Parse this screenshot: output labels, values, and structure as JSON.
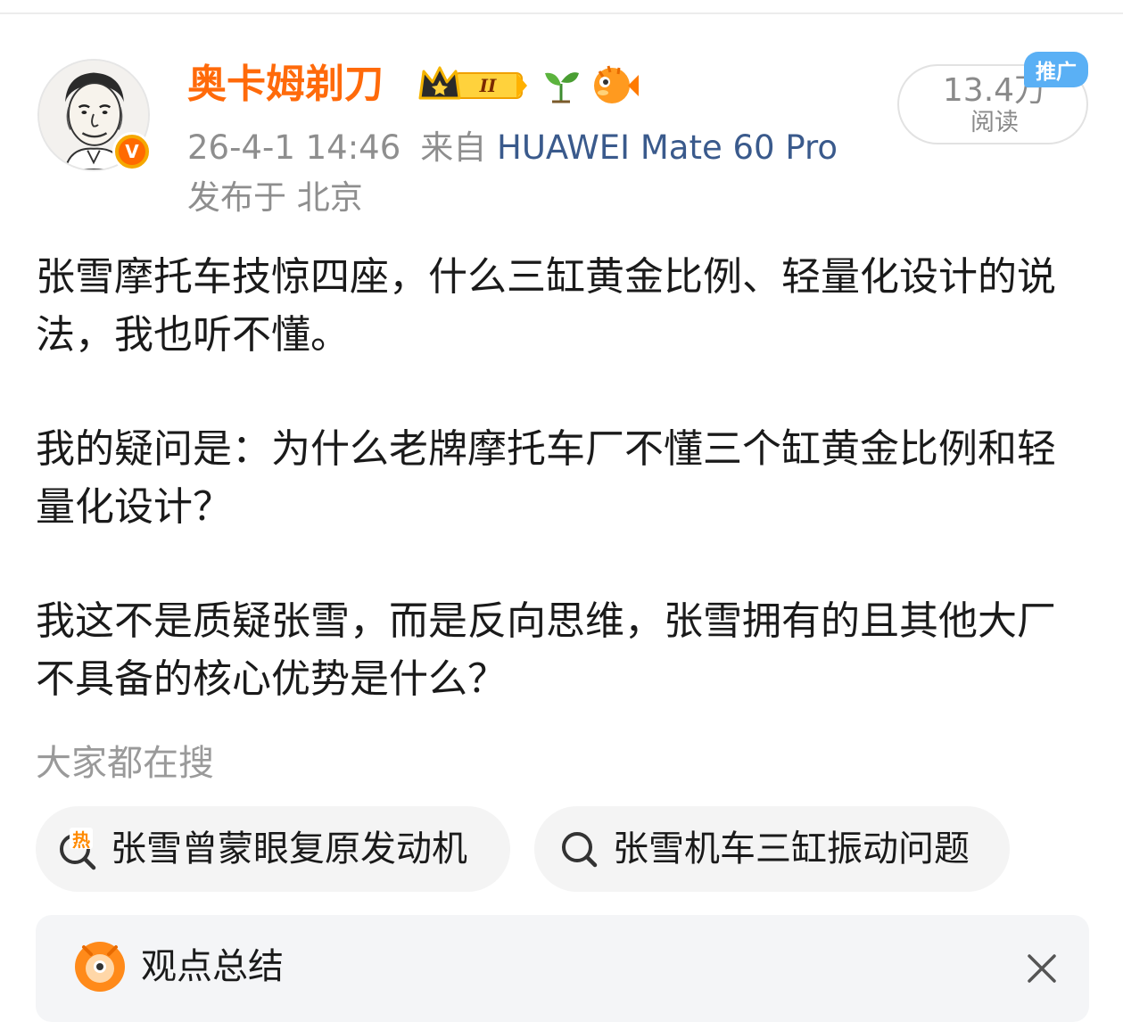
{
  "post": {
    "author": {
      "name": "奥卡姆剃刀",
      "verified_badge": "V",
      "level_badge": "II"
    },
    "meta": {
      "time": "26-4-1 14:46",
      "source_prefix": "来自",
      "device": "HUAWEI Mate 60 Pro",
      "location": "发布于 北京"
    },
    "reads": {
      "count": "13.4万",
      "label": "阅读",
      "promo_tag": "推广"
    },
    "paragraphs": [
      "张雪摩托车技惊四座，什么三缸黄金比例、轻量化设计的说法，我也听不懂。",
      "我的疑问是：为什么老牌摩托车厂不懂三个缸黄金比例和轻量化设计？",
      "我这不是质疑张雪，而是反向思维，张雪拥有的且其他大厂不具备的核心优势是什么？"
    ]
  },
  "search": {
    "title": "大家都在搜",
    "hot_icon_label": "热",
    "chips": [
      {
        "label": "张雪曾蒙眼复原发动机",
        "icon": "hot-search-icon"
      },
      {
        "label": "张雪机车三缸振动问题",
        "icon": "search-icon"
      }
    ]
  },
  "summary": {
    "title": "观点总结",
    "icons": [
      "mascot-icon",
      "close-icon"
    ]
  },
  "colors": {
    "username": "#ff6a0a",
    "device_link": "#3a5a8c",
    "promo_tag": "#5ab0f5",
    "verified": "#ff6a00",
    "hot_icon": "#ff8a00"
  }
}
